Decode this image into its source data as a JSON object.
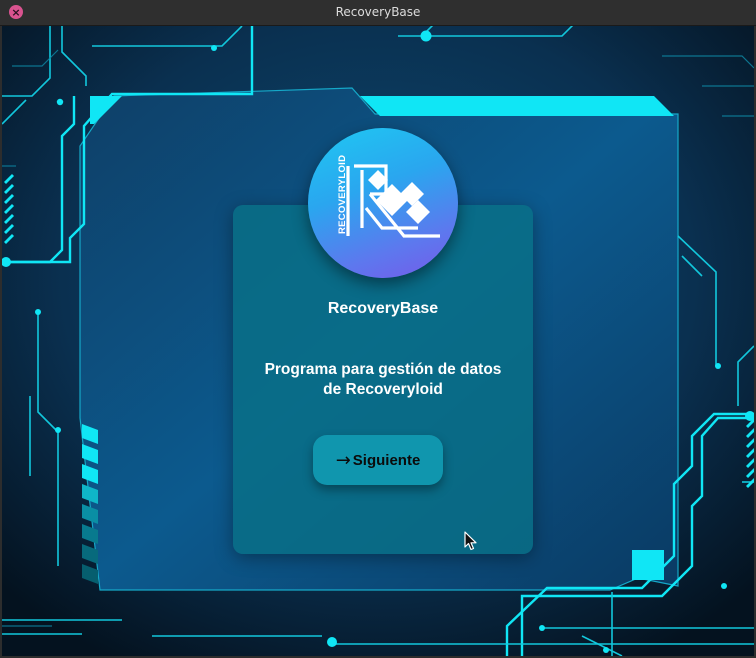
{
  "window": {
    "title": "RecoveryBase",
    "close_glyph": "×"
  },
  "logo": {
    "vertical_text": "RECOVERYLOID",
    "icon": "recoveryloid-logo-icon"
  },
  "card": {
    "app_name": "RecoveryBase",
    "description_line1": "Programa para gestión de datos",
    "description_line2": "de Recoveryloid"
  },
  "next_button": {
    "label": "Siguiente",
    "icon": "arrow-right-icon",
    "arrow_glyph": "→"
  },
  "colors": {
    "background_dark": "#071a2a",
    "circuit_cyan": "#10e6f5",
    "card": "#087087",
    "button": "#1096ae",
    "logo_gradient_start": "#1fc8f2",
    "logo_gradient_end": "#7659ea",
    "close_button": "#d9538f"
  }
}
